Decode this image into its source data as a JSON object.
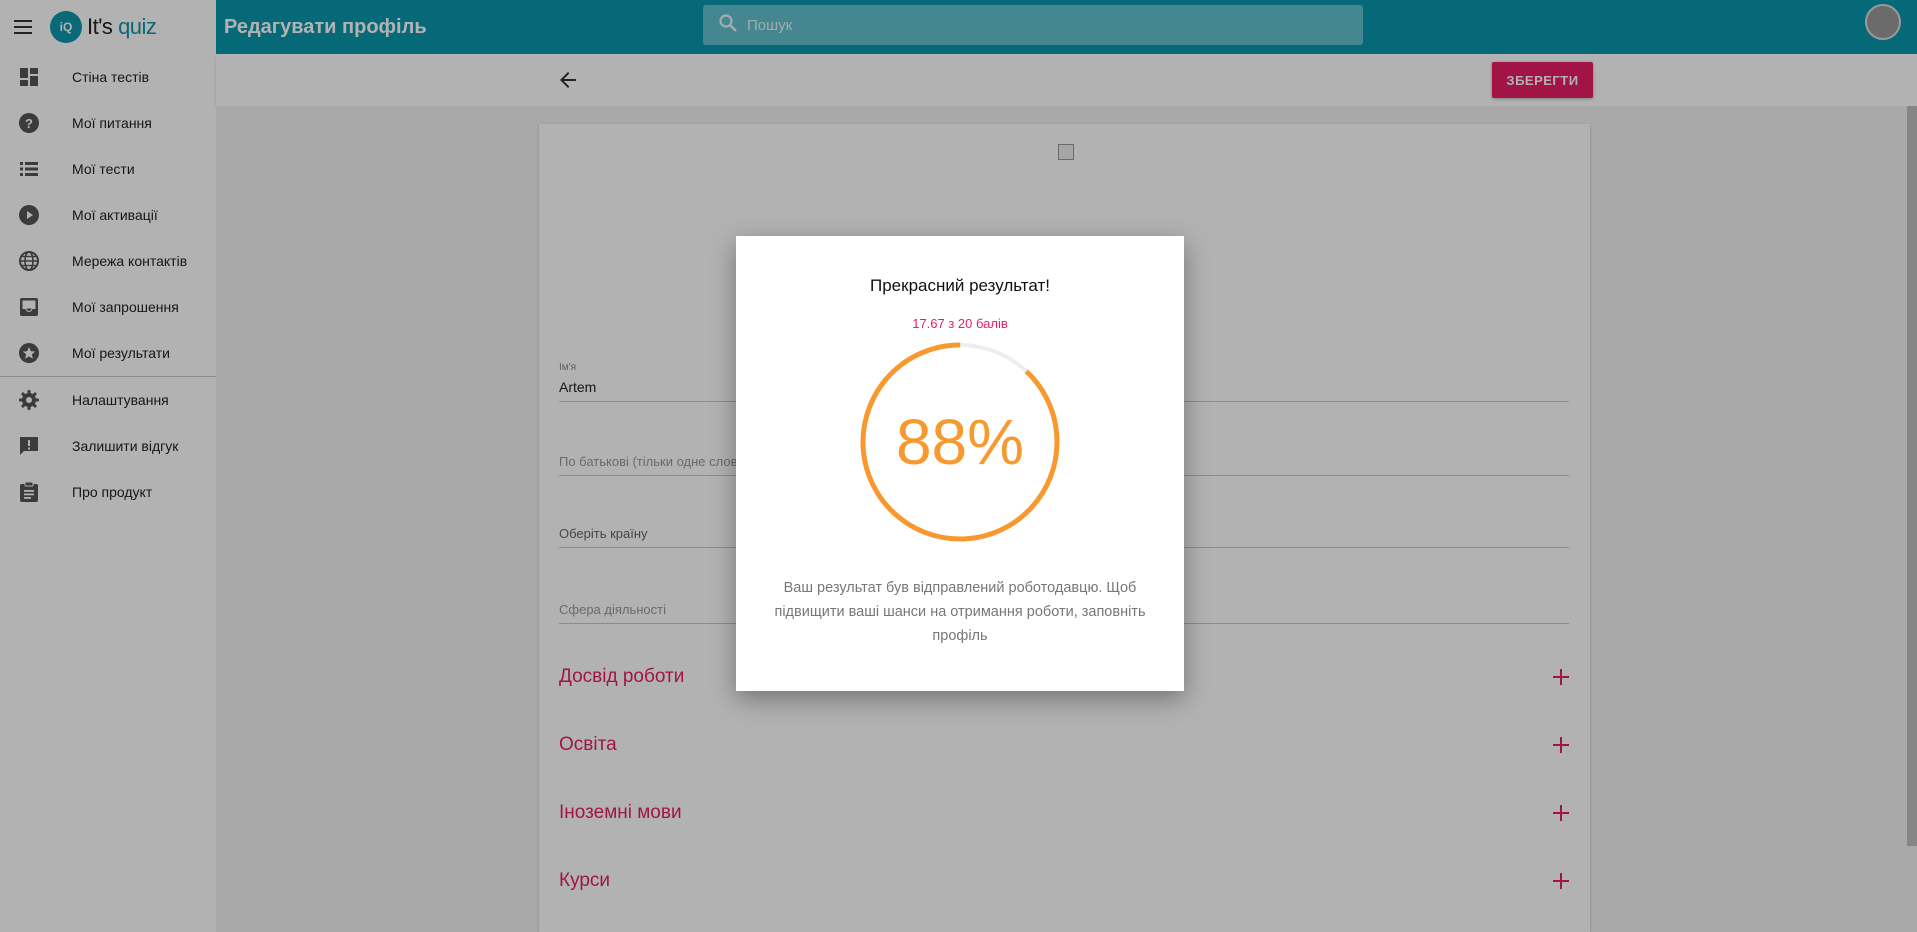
{
  "app": {
    "logo_text_a": "It's",
    "logo_text_b": "quiz",
    "logo_mark": "iQ"
  },
  "sidebar": {
    "items": [
      {
        "label": "Стіна тестів",
        "icon": "dashboard-icon"
      },
      {
        "label": "Мої питання",
        "icon": "help-circle-icon"
      },
      {
        "label": "Мої тести",
        "icon": "list-icon"
      },
      {
        "label": "Мої активації",
        "icon": "play-circle-icon"
      },
      {
        "label": "Мережа контактів",
        "icon": "globe-icon"
      },
      {
        "label": "Мої запрошення",
        "icon": "inbox-icon"
      },
      {
        "label": "Мої результати",
        "icon": "star-circle-icon"
      },
      {
        "label": "Налаштування",
        "icon": "gear-icon"
      },
      {
        "label": "Залишити відгук",
        "icon": "feedback-icon"
      },
      {
        "label": "Про продукт",
        "icon": "clipboard-icon"
      }
    ]
  },
  "header": {
    "title": "Редагувати профіль",
    "search_placeholder": "Пошук"
  },
  "toolbar": {
    "save_label": "ЗБЕРЕГТИ"
  },
  "form": {
    "name_label": "Ім'я",
    "name_value": "Artem",
    "patronymic_placeholder": "По батькові (тільки одне слово)",
    "country_placeholder": "Оберіть країну",
    "sphere_placeholder": "Сфера діяльності",
    "sections": [
      "Досвід роботи",
      "Освіта",
      "Іноземні мови",
      "Курси"
    ]
  },
  "modal": {
    "title": "Прекрасний результат!",
    "score": "17.67 з 20 балів",
    "percent_text": "88%",
    "percent_value": 88,
    "message": "Ваш результат був відправлений роботодавцю. Щоб підвищити ваші шанси на отримання роботи, заповніть профіль"
  },
  "colors": {
    "brand": "#0a97ad",
    "accent": "#e91e63",
    "progress": "#f7992e"
  }
}
